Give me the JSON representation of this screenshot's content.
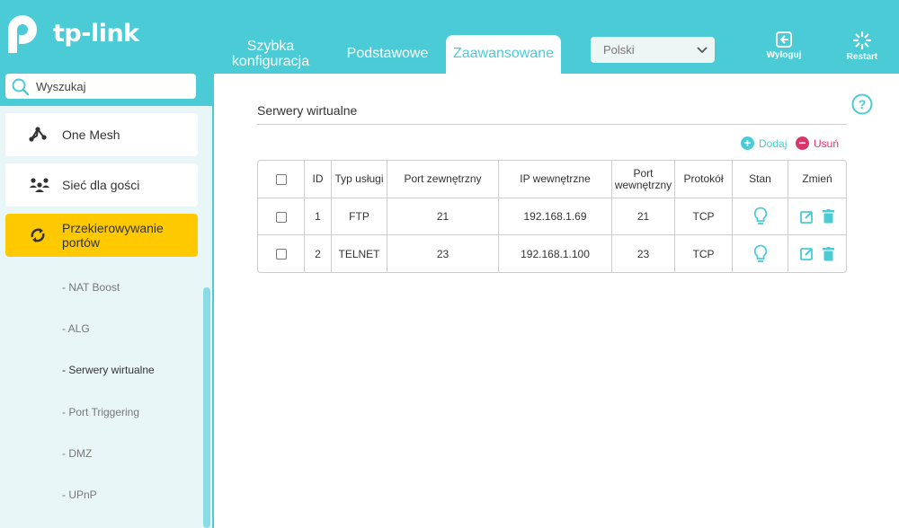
{
  "brand": {
    "name": "tp-link"
  },
  "nav": {
    "tabs": [
      {
        "label_line1": "Szybka",
        "label_line2": "konfiguracja"
      },
      {
        "label": "Podstawowe"
      },
      {
        "label": "Zaawansowane",
        "active": true
      }
    ],
    "language": "Polski",
    "logout_label": "Wyloguj",
    "restart_label": "Restart"
  },
  "sidebar": {
    "search_placeholder": "Wyszukaj",
    "items": [
      {
        "label": "One Mesh",
        "icon": "one-mesh-icon"
      },
      {
        "label": "Sieć dla gości",
        "icon": "guests-icon"
      },
      {
        "label": "Przekierowywanie portów",
        "icon": "port-forwarding-icon",
        "active": true
      }
    ],
    "subitems": [
      {
        "label": "- NAT Boost"
      },
      {
        "label": "- ALG"
      },
      {
        "label": "- Serwery wirtualne",
        "current": true
      },
      {
        "label": "- Port Triggering"
      },
      {
        "label": "- DMZ"
      },
      {
        "label": "- UPnP"
      }
    ]
  },
  "main": {
    "title": "Serwery wirtualne",
    "add_label": "Dodaj",
    "delete_label": "Usuń",
    "columns": [
      "ID",
      "Typ usługi",
      "Port zewnętrzny",
      "IP wewnętrzne",
      "Port wewnętrzny",
      "Protokół",
      "Stan",
      "Zmień"
    ],
    "rows": [
      {
        "id": "1",
        "service": "FTP",
        "ext_port": "21",
        "int_ip": "192.168.1.69",
        "int_port": "21",
        "protocol": "TCP"
      },
      {
        "id": "2",
        "service": "TELNET",
        "ext_port": "23",
        "int_ip": "192.168.1.100",
        "int_port": "23",
        "protocol": "TCP"
      }
    ]
  },
  "colors": {
    "accent": "#4acbd6",
    "active_item": "#ffc900",
    "delete": "#d8356b"
  }
}
